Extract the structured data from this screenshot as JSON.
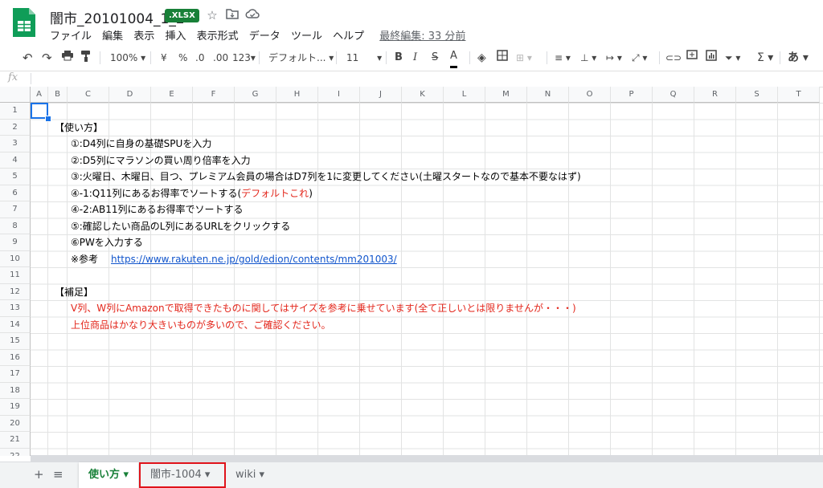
{
  "header": {
    "title": "闇市_20101004_1_2",
    "badge": ".XLSX",
    "star_icon": "star-icon",
    "folder_icon": "move-folder-icon",
    "cloud_icon": "cloud-status-icon"
  },
  "menu": [
    "ファイル",
    "編集",
    "表示",
    "挿入",
    "表示形式",
    "データ",
    "ツール",
    "ヘルプ"
  ],
  "last_edit": "最終編集: 33 分前",
  "toolbar": {
    "zoom": "100%",
    "currency": "¥",
    "percent": "%",
    "dec_decrease": ".0",
    "dec_increase": ".00",
    "format_123": "123",
    "font": "デフォルト...",
    "font_size": "11",
    "bold": "B",
    "italic": "I",
    "strike": "S",
    "textcolor": "A",
    "sigma": "Σ",
    "input_tool": "あ"
  },
  "formula_bar": {
    "fx": "fx"
  },
  "columns": [
    "A",
    "B",
    "C",
    "D",
    "E",
    "F",
    "G",
    "H",
    "I",
    "J",
    "K",
    "L",
    "M",
    "N",
    "O",
    "P",
    "Q",
    "R",
    "S",
    "T"
  ],
  "rows": [
    "1",
    "2",
    "3",
    "4",
    "5",
    "6",
    "7",
    "8",
    "9",
    "10",
    "11",
    "12",
    "13",
    "14",
    "15",
    "16",
    "17",
    "18",
    "19",
    "20",
    "21",
    "22"
  ],
  "cells": {
    "r2": "【使い方】",
    "r3": "①:D4列に自身の基礎SPUを入力",
    "r4": "②:D5列にマラソンの買い周り倍率を入力",
    "r5": "③:火曜日、木曜日、目つ、プレミアム会員の場合はD7列を1に変更してください(土曜スタートなので基本不要なはず)",
    "r6a": "④-1:Q11列にあるお得率でソートする(",
    "r6b": "デフォルトこれ",
    "r6c": ")",
    "r7": "④-2:AB11列にあるお得率でソートする",
    "r8": "⑤:確認したい商品のL列にあるURLをクリックする",
    "r9": "⑥PWを入力する",
    "r10a": "※参考",
    "r10b": "https://www.rakuten.ne.jp/gold/edion/contents/mm201003/",
    "r12": "【補足】",
    "r13": "V列、W列にAmazonで取得できたものに関してはサイズを参考に乗せています(全て正しいとは限りませんが・・・)",
    "r14": "上位商品はかなり大きいものが多いので、ご確認ください。"
  },
  "tabs": {
    "add": "+",
    "list": "≡",
    "items": [
      {
        "label": "使い方"
      },
      {
        "label": "闇市-1004"
      },
      {
        "label": "wiki"
      }
    ]
  },
  "colors": {
    "accent_green": "#188038",
    "red_text": "#e3261b",
    "highlight_box": "#e0131a",
    "link": "#1155cc"
  }
}
